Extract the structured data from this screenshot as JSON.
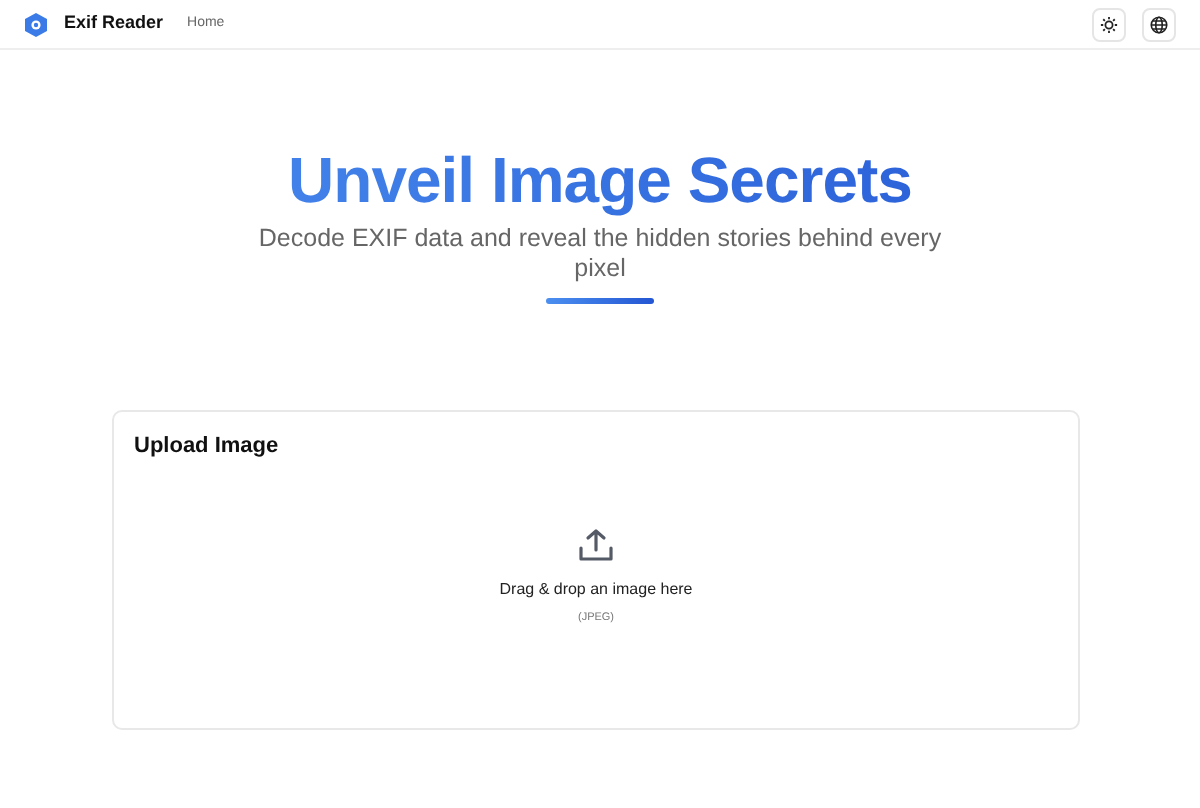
{
  "navbar": {
    "brand": "Exif Reader",
    "links": [
      {
        "label": "Home",
        "selected": false
      }
    ]
  },
  "hero": {
    "title": "Unveil Image Secrets",
    "subtitle": "Decode EXIF data and reveal the hidden stories behind every pixel"
  },
  "upload_card": {
    "title": "Upload Image",
    "dropzone_text": "Drag & drop an image here",
    "formats": "(JPEG)"
  }
}
